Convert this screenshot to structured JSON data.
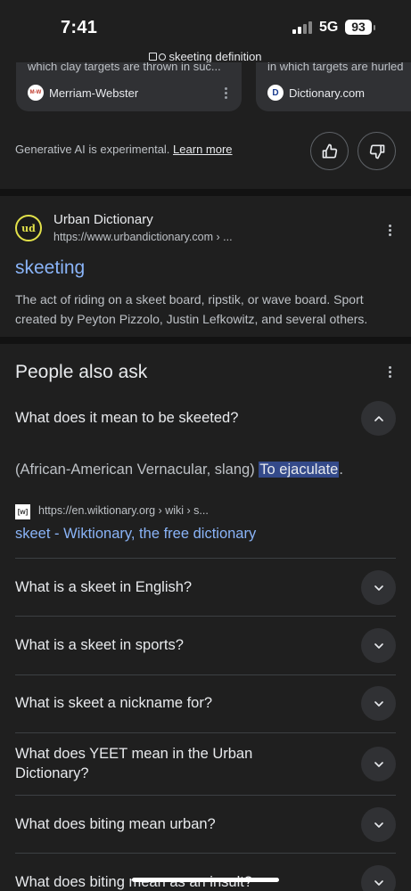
{
  "status": {
    "time": "7:41",
    "network": "5G",
    "battery": "93"
  },
  "url_bar": {
    "query": "skeeting definition"
  },
  "cards": [
    {
      "snippet": "which clay targets are thrown in suc...",
      "source": "Merriam-Webster",
      "favicon": "M-W"
    },
    {
      "snippet": "in which targets are hurled",
      "source": "Dictionary.com",
      "favicon": "D"
    }
  ],
  "ai_note": {
    "text": "Generative AI is experimental.",
    "link": "Learn more"
  },
  "result": {
    "site_name": "Urban Dictionary",
    "url": "https://www.urbandictionary.com › ...",
    "logo": "ud",
    "title": "skeeting",
    "description": "The act of riding on a skeet board, ripstik, or wave board. Sport created by Peyton Pizzolo, Justin Lefkowitz, and several others."
  },
  "paa": {
    "title": "People also ask",
    "expanded": {
      "question": "What does it mean to be skeeted?",
      "answer_prefix": "(African-American Vernacular, slang)",
      "answer_highlight": "To ejaculate",
      "answer_suffix": ".",
      "source_favicon": "[w]",
      "source_url": "https://en.wiktionary.org › wiki › s...",
      "source_title": "skeet - Wiktionary, the free dictionary"
    },
    "questions": [
      "What is a skeet in English?",
      "What is a skeet in sports?",
      "What is skeet a nickname for?",
      "What does YEET mean in the Urban Dictionary?",
      "What does biting mean urban?",
      "What does biting mean as an insult?"
    ]
  }
}
